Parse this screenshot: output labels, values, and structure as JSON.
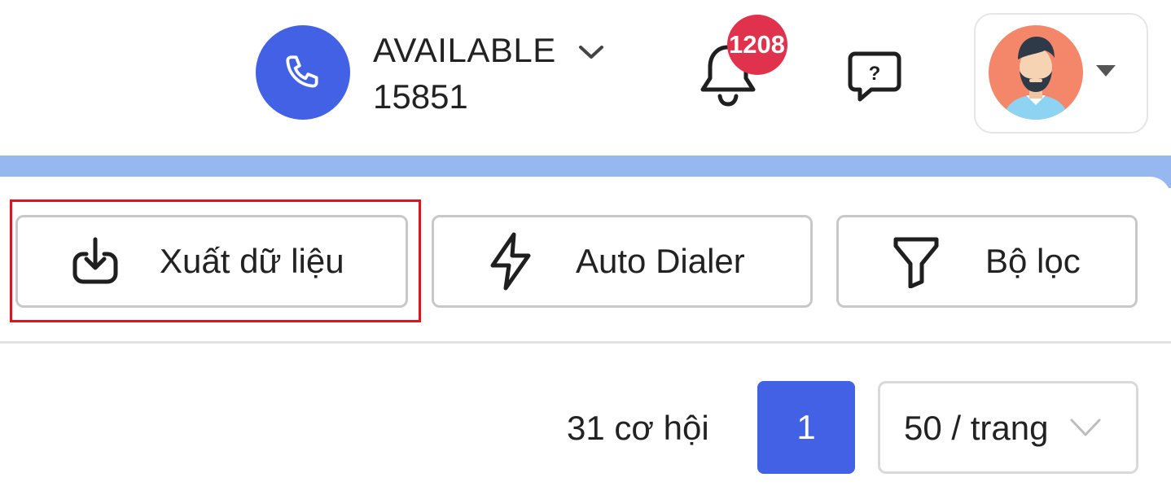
{
  "header": {
    "status": "AVAILABLE",
    "extension": "15851",
    "notification_count": "1208"
  },
  "toolbar": {
    "export_label": "Xuất dữ liệu",
    "auto_dialer_label": "Auto Dialer",
    "filter_label": "Bộ lọc"
  },
  "pagination": {
    "count_label": "31 cơ hội",
    "current_page": "1",
    "page_size": "50 / trang"
  },
  "colors": {
    "accent": "#4361e4",
    "badge": "#e0324c",
    "band": "#97b7f0",
    "highlight_box": "#e0141e"
  },
  "icons": [
    "phone-icon",
    "chevron-down-icon",
    "bell-icon",
    "help-chat-icon",
    "avatar",
    "caret-down-icon",
    "download-icon",
    "lightning-icon",
    "filter-icon"
  ]
}
